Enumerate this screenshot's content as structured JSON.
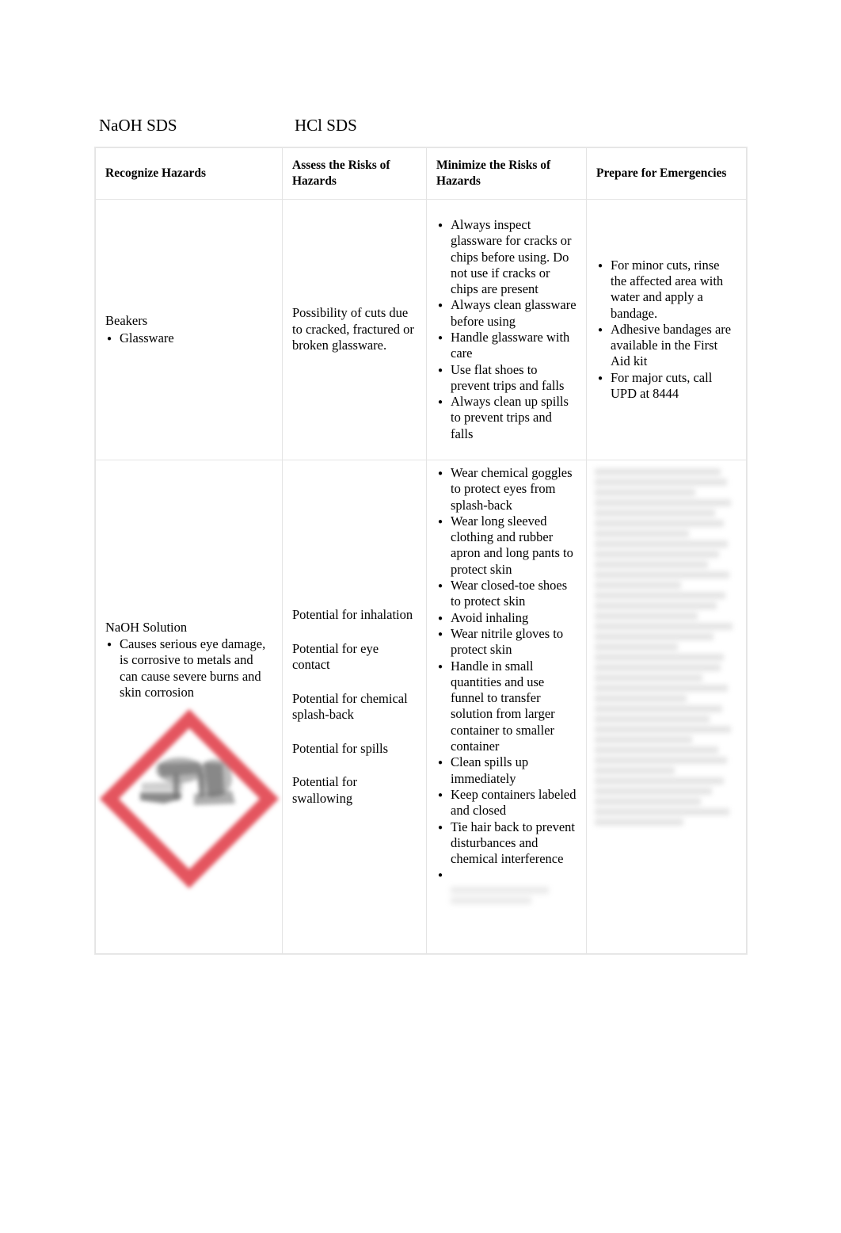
{
  "document": {
    "links": [
      {
        "label": "NaOH SDS",
        "name": "naoh-sds-link"
      },
      {
        "label": "HCl SDS",
        "name": "hcl-sds-link"
      }
    ]
  },
  "table": {
    "headers": [
      "Recognize Hazards",
      "Assess the Risks of Hazards",
      "Minimize the Risks of Hazards",
      "Prepare for Emergencies"
    ],
    "rows": [
      {
        "recognize": {
          "title": "Beakers",
          "bullets": [
            "Glassware"
          ]
        },
        "assess": {
          "paragraphs": [
            "Possibility of cuts due to cracked, fractured or broken glassware."
          ]
        },
        "minimize": {
          "bullets": [
            "Always inspect glassware for cracks or chips before using. Do not use if cracks or chips are present",
            "Always clean glassware before using",
            "Handle glassware with care",
            "Use flat shoes to prevent trips and falls",
            "Always clean up spills to prevent trips and falls"
          ]
        },
        "prepare": {
          "bullets": [
            "For minor cuts, rinse the affected area with water and apply a bandage.",
            "Adhesive bandages are available in the First Aid kit",
            "For major cuts, call UPD at 8444"
          ]
        }
      },
      {
        "recognize": {
          "title": "NaOH Solution",
          "bullets": [
            "Causes serious eye damage, is corrosive to metals and can cause severe burns and skin corrosion"
          ],
          "pictogram": "ghs-corrosion-pictogram"
        },
        "assess": {
          "paragraphs": [
            "Potential for inhalation",
            "Potential for eye contact",
            "Potential for chemical splash-back",
            "Potential for spills",
            "Potential for swallowing"
          ]
        },
        "minimize": {
          "bullets": [
            "Wear chemical goggles to protect eyes from splash-back",
            "Wear long sleeved clothing and rubber apron and long pants to protect skin",
            "Wear closed-toe shoes to protect skin",
            "Avoid inhaling",
            "Wear nitrile gloves to protect skin",
            "Handle in small quantities and use funnel to transfer solution from larger container to smaller container",
            "Clean spills up immediately",
            "Keep containers labeled and closed",
            "Tie hair back to prevent disturbances and chemical interference"
          ],
          "redacted_bullet": ""
        },
        "prepare": {
          "redacted": true
        }
      }
    ]
  },
  "colors": {
    "pictogram_border": "#e4555f",
    "table_border": "#e4e4e4",
    "text": "#000000"
  }
}
